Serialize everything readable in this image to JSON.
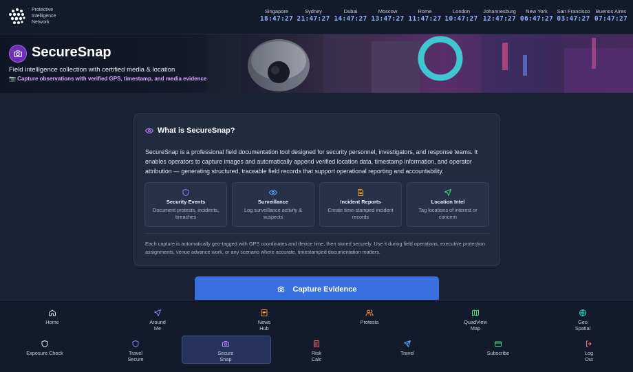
{
  "header": {
    "brand_lines": [
      "Protective",
      "Intelligence",
      "Network"
    ],
    "clocks": [
      {
        "city": "Singapore",
        "time": "18:47:27"
      },
      {
        "city": "Sydney",
        "time": "21:47:27"
      },
      {
        "city": "Dubai",
        "time": "14:47:27"
      },
      {
        "city": "Moscow",
        "time": "13:47:27"
      },
      {
        "city": "Rome",
        "time": "11:47:27"
      },
      {
        "city": "London",
        "time": "10:47:27"
      },
      {
        "city": "Johannesburg",
        "time": "12:47:27"
      },
      {
        "city": "New York",
        "time": "06:47:27"
      },
      {
        "city": "San Francisco",
        "time": "03:47:27"
      },
      {
        "city": "Buenos Aires",
        "time": "07:47:27"
      }
    ]
  },
  "hero": {
    "title": "SecureSnap",
    "subtitle": "Field intelligence collection with certified media & location",
    "tagline": "📷 Capture observations with verified GPS, timestamp, and media evidence"
  },
  "about": {
    "heading": "What is SecureSnap?",
    "body": "SecureSnap is a professional field documentation tool designed for security personnel, investigators, and response teams. It enables operators to capture images and automatically append verified location data, timestamp information, and operator attribution — generating structured, traceable field records that support operational reporting and accountability.",
    "features": [
      {
        "title": "Security Events",
        "desc": "Document protests, incidents, breaches",
        "icon": "shield-icon",
        "color": "#8b7cf6"
      },
      {
        "title": "Surveillance",
        "desc": "Log surveillance activity & suspects",
        "icon": "eye-icon",
        "color": "#60a5fa"
      },
      {
        "title": "Incident Reports",
        "desc": "Create time-stamped incident records",
        "icon": "document-icon",
        "color": "#f59e0b"
      },
      {
        "title": "Location Intel",
        "desc": "Tag locations of interest or concern",
        "icon": "navigation-icon",
        "color": "#4ade80"
      }
    ],
    "footer": "Each capture is automatically geo-tagged with GPS coordinates and device time, then stored securely. Use it during field operations, executive protection assignments, venue advance work, or any scenario where accurate, timestamped documentation matters."
  },
  "capture_button": "Capture Evidence",
  "nav": {
    "row1": [
      {
        "label": "Home",
        "icon": "home-icon",
        "color": "#e2e8f0"
      },
      {
        "label": "Around\nMe",
        "icon": "navigation-icon",
        "color": "#818cf8"
      },
      {
        "label": "News\nHub",
        "icon": "newspaper-icon",
        "color": "#fb923c"
      },
      {
        "label": "Protests",
        "icon": "users-icon",
        "color": "#fb923c"
      },
      {
        "label": "QuadView\nMap",
        "icon": "map-icon",
        "color": "#4ade80"
      },
      {
        "label": "Geo\nSpatial",
        "icon": "globe-icon",
        "color": "#2dd4bf"
      }
    ],
    "row2": [
      {
        "label": "Exposure Check",
        "icon": "shield-icon",
        "color": "#e2e8f0"
      },
      {
        "label": "Travel\nSecure",
        "icon": "shield-icon",
        "color": "#818cf8"
      },
      {
        "label": "Secure\nSnap",
        "icon": "camera-icon",
        "color": "#c084fc",
        "active": true
      },
      {
        "label": "Risk\nCalc",
        "icon": "calculator-icon",
        "color": "#f87171"
      },
      {
        "label": "Travel",
        "icon": "plane-icon",
        "color": "#60a5fa"
      },
      {
        "label": "Subscribe",
        "icon": "card-icon",
        "color": "#4ade80"
      },
      {
        "label": "Log\nOut",
        "icon": "logout-icon",
        "color": "#f87171"
      }
    ]
  }
}
